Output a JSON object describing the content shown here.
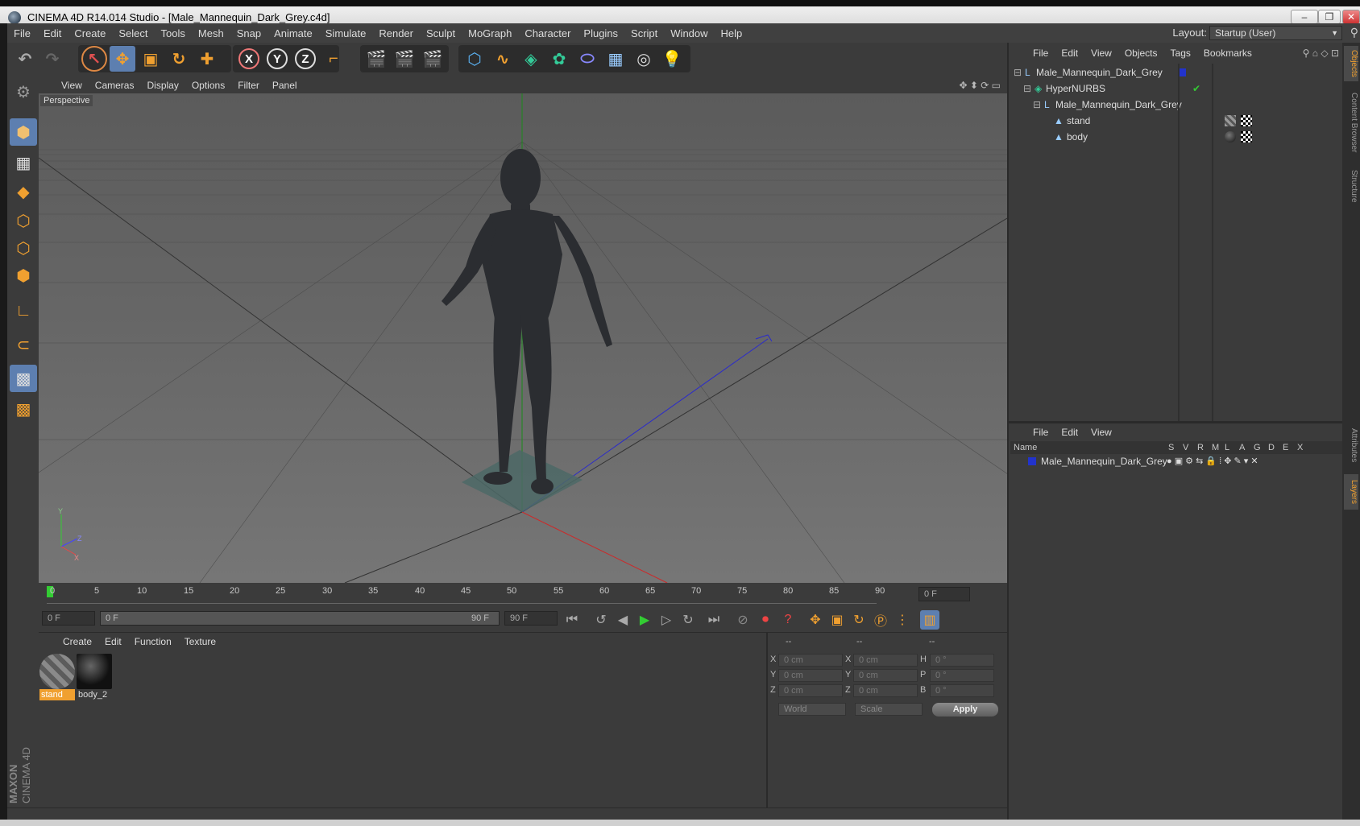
{
  "window": {
    "title": "CINEMA 4D R14.014 Studio - [Male_Mannequin_Dark_Grey.c4d]",
    "minimize": "–",
    "maximize": "❐",
    "close": "✕"
  },
  "menubar": {
    "items": [
      "File",
      "Edit",
      "Create",
      "Select",
      "Tools",
      "Mesh",
      "Snap",
      "Animate",
      "Simulate",
      "Render",
      "Sculpt",
      "MoGraph",
      "Character",
      "Plugins",
      "Script",
      "Window",
      "Help"
    ],
    "layout_label": "Layout:",
    "layout_value": "Startup (User)"
  },
  "viewport": {
    "menu": [
      "View",
      "Cameras",
      "Display",
      "Options",
      "Filter",
      "Panel"
    ],
    "camera_label": "Perspective",
    "axis_y": "Y",
    "axis_z": "Z",
    "axis_x": "X"
  },
  "timeline": {
    "ticks": [
      "0",
      "5",
      "10",
      "15",
      "20",
      "25",
      "30",
      "35",
      "40",
      "45",
      "50",
      "55",
      "60",
      "65",
      "70",
      "75",
      "80",
      "85",
      "90"
    ],
    "current_frame": "0 F"
  },
  "transport": {
    "start_field": "0 F",
    "range_start": "0 F",
    "range_end": "90 F",
    "end_field": "90 F"
  },
  "materials": {
    "menu": [
      "Create",
      "Edit",
      "Function",
      "Texture"
    ],
    "items": [
      {
        "name": "stand"
      },
      {
        "name": "body_2"
      }
    ]
  },
  "coordinates": {
    "headers": [
      "--",
      "--",
      "--"
    ],
    "rows": [
      {
        "a": "X",
        "av": "0 cm",
        "b": "X",
        "bv": "0 cm",
        "c": "H",
        "cv": "0 °"
      },
      {
        "a": "Y",
        "av": "0 cm",
        "b": "Y",
        "bv": "0 cm",
        "c": "P",
        "cv": "0 °"
      },
      {
        "a": "Z",
        "av": "0 cm",
        "b": "Z",
        "bv": "0 cm",
        "c": "B",
        "cv": "0 °"
      }
    ],
    "world": "World",
    "scale": "Scale",
    "apply": "Apply"
  },
  "objects": {
    "menu": [
      "File",
      "Edit",
      "View",
      "Objects",
      "Tags",
      "Bookmarks"
    ],
    "tree": [
      {
        "name": "Male_Mannequin_Dark_Grey",
        "indent": 0
      },
      {
        "name": "HyperNURBS",
        "indent": 1
      },
      {
        "name": "Male_Mannequin_Dark_Grey",
        "indent": 2
      },
      {
        "name": "stand",
        "indent": 3
      },
      {
        "name": "body",
        "indent": 3
      }
    ]
  },
  "layers": {
    "menu": [
      "File",
      "Edit",
      "View"
    ],
    "col_name": "Name",
    "cols": [
      "S",
      "V",
      "R",
      "M",
      "L",
      "A",
      "G",
      "D",
      "E",
      "X"
    ],
    "rows": [
      {
        "name": "Male_Mannequin_Dark_Grey"
      }
    ]
  },
  "sidetabs": [
    "Objects",
    "Content Browser",
    "Structure",
    "Attributes",
    "Layers"
  ],
  "brand": {
    "line1": "MAXON",
    "line2": "CINEMA 4D"
  }
}
